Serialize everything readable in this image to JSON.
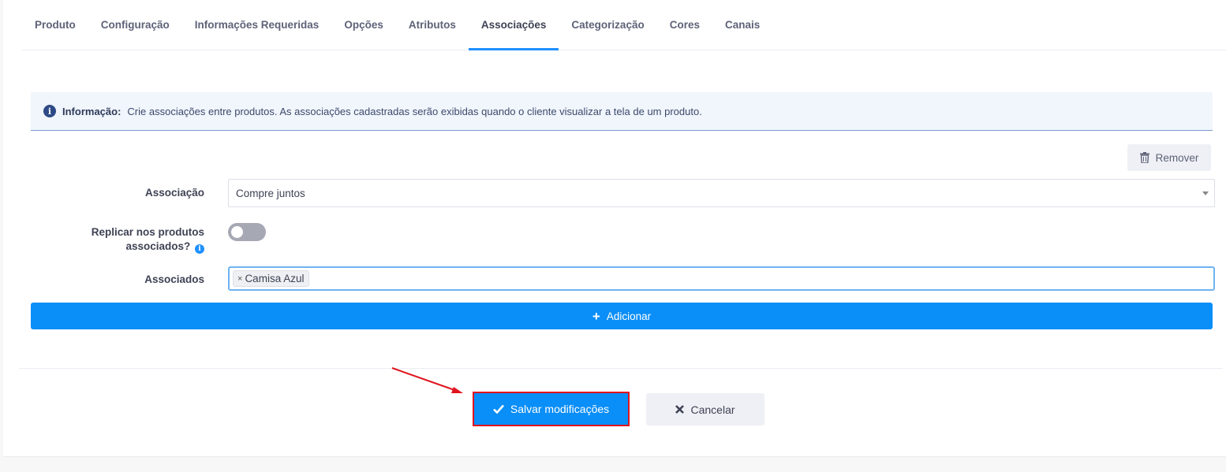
{
  "tabs": [
    {
      "label": "Produto"
    },
    {
      "label": "Configuração"
    },
    {
      "label": "Informações Requeridas"
    },
    {
      "label": "Opções"
    },
    {
      "label": "Atributos"
    },
    {
      "label": "Associações",
      "active": true
    },
    {
      "label": "Categorização"
    },
    {
      "label": "Cores"
    },
    {
      "label": "Canais"
    }
  ],
  "alert": {
    "icon": "info-icon",
    "label": "Informação:",
    "text": "Crie associações entre produtos. As associações cadastradas serão exibidas quando o cliente visualizar a tela de um produto."
  },
  "remove_button": {
    "icon": "trash-icon",
    "label": "Remover"
  },
  "form": {
    "association": {
      "label": "Associação",
      "value": "Compre juntos"
    },
    "replicate": {
      "label_line1": "Replicar nos produtos",
      "label_line2": "associados?",
      "enabled": false
    },
    "associated": {
      "label": "Associados",
      "tags": [
        "Camisa Azul"
      ]
    }
  },
  "add_button": {
    "icon": "plus-icon",
    "label": "Adicionar"
  },
  "footer": {
    "save_label": "Salvar modificações",
    "cancel_label": "Cancelar"
  },
  "colors": {
    "primary": "#0a8ef7",
    "highlight": "#e0141e",
    "tab_active_border": "#1e90ff"
  }
}
